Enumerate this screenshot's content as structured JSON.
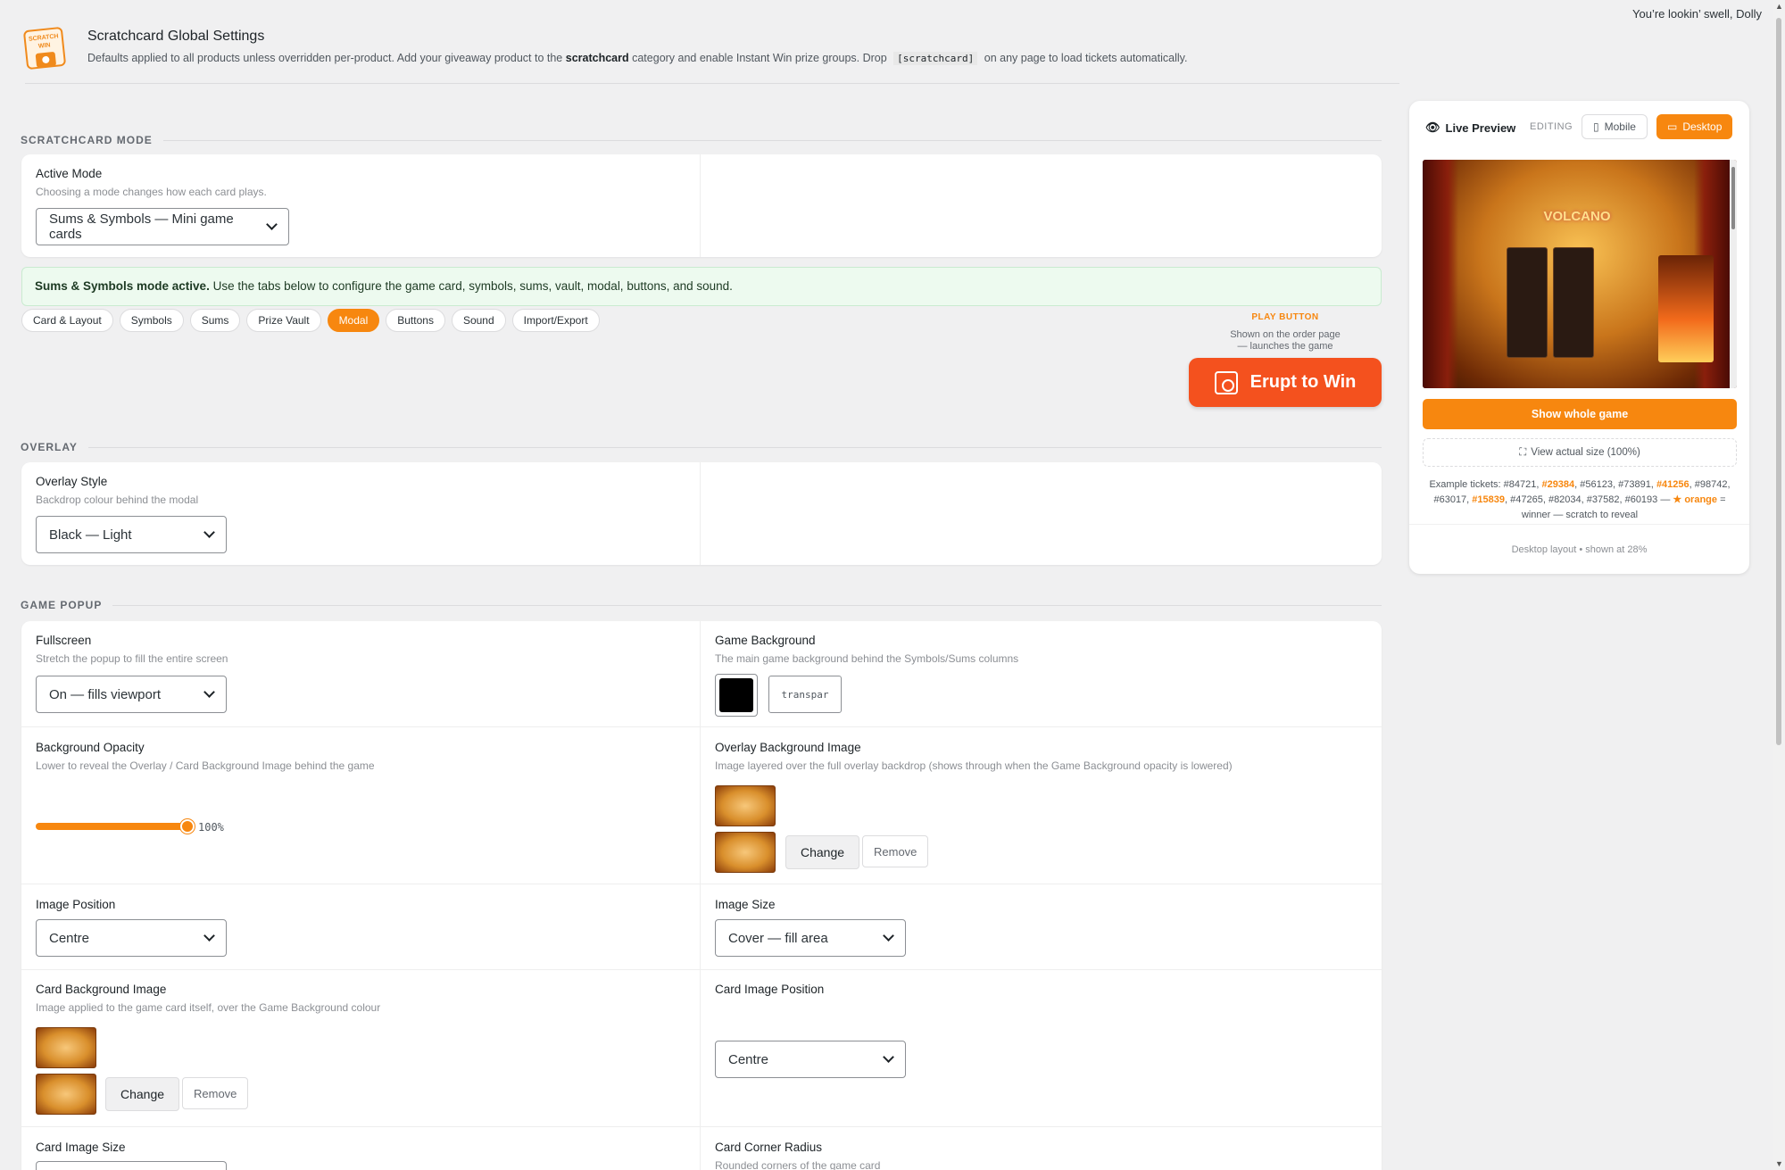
{
  "topbar": {
    "greeting": "You’re lookin’ swell, Dolly"
  },
  "header": {
    "logo_text": "SCRATCH WIN",
    "title": "Scratchcard Global Settings",
    "desc_a": "Defaults applied to all products unless overridden per-product. Add your giveaway product to the",
    "desc_bold": "scratchcard",
    "desc_b": "category and enable Instant Win prize groups. Drop",
    "desc_code": "[scratchcard]",
    "desc_c": "on any page to load tickets automatically."
  },
  "sections": {
    "mode": "SCRATCHCARD MODE",
    "overlay": "OVERLAY",
    "popup": "GAME POPUP"
  },
  "mode": {
    "label": "Active Mode",
    "hint": "Choosing a mode changes how each card plays.",
    "value": "Sums & Symbols — Mini game cards"
  },
  "notice": {
    "bold": "Sums & Symbols mode active.",
    "text": "Use the tabs below to configure the game card, symbols, sums, vault, modal, buttons, and sound."
  },
  "tabs": [
    {
      "label": "Card & Layout"
    },
    {
      "label": "Symbols"
    },
    {
      "label": "Sums"
    },
    {
      "label": "Prize Vault"
    },
    {
      "label": "Modal"
    },
    {
      "label": "Buttons"
    },
    {
      "label": "Sound"
    },
    {
      "label": "Import/Export"
    }
  ],
  "play_button": {
    "caption": "PLAY BUTTON",
    "desc1": "Shown on the order page",
    "desc2": "— launches the game",
    "label": "Erupt to Win"
  },
  "overlay": {
    "label": "Overlay Style",
    "hint": "Backdrop colour behind the modal",
    "value": "Black — Light"
  },
  "popup": {
    "fullscreen": {
      "label": "Fullscreen",
      "hint": "Stretch the popup to fill the entire screen",
      "value": "On — fills viewport"
    },
    "game_bg": {
      "label": "Game Background",
      "hint": "The main game background behind the Symbols/Sums columns",
      "color": "#000000",
      "text": "transpar"
    },
    "bg_opacity": {
      "label": "Background Opacity",
      "hint": "Lower to reveal the Overlay / Card Background Image behind the game",
      "value": "100%",
      "percent": 100
    },
    "overlay_img": {
      "label": "Overlay Background Image",
      "hint": "Image layered over the full overlay backdrop (shows through when the Game Background opacity is lowered)",
      "change": "Change",
      "remove": "Remove"
    },
    "img_position": {
      "label": "Image Position",
      "value": "Centre"
    },
    "img_size": {
      "label": "Image Size",
      "value": "Cover — fill area"
    },
    "card_bg_img": {
      "label": "Card Background Image",
      "hint": "Image applied to the game card itself, over the Game Background colour",
      "change": "Change",
      "remove": "Remove"
    },
    "card_img_position": {
      "label": "Card Image Position",
      "value": "Centre"
    },
    "card_img_size": {
      "label": "Card Image Size"
    },
    "card_radius": {
      "label": "Card Corner Radius",
      "hint": "Rounded corners of the game card"
    }
  },
  "preview": {
    "title": "Live Preview",
    "editing": "EDITING",
    "mobile": "Mobile",
    "desktop": "Desktop",
    "game_logo": "VOLCANO",
    "show_whole": "Show whole game",
    "actual_size": "View actual size (100%)",
    "tickets_prefix": "Example tickets:",
    "t1": "#84721,",
    "t2": "#29384",
    "t3": ", #56123, #73891,",
    "t4": "#41256",
    "t5": ", #98742, #63017,",
    "t6": "#15839",
    "t7": ", #47265, #82034, #37582, #60193 —",
    "t8": "★ orange",
    "t9": "= winner — scratch to reveal",
    "footer": "Desktop layout • shown at 28%"
  },
  "colors": {
    "accent": "#f7870f",
    "play_button": "#f4511e",
    "notice_bg": "#edfaef"
  }
}
